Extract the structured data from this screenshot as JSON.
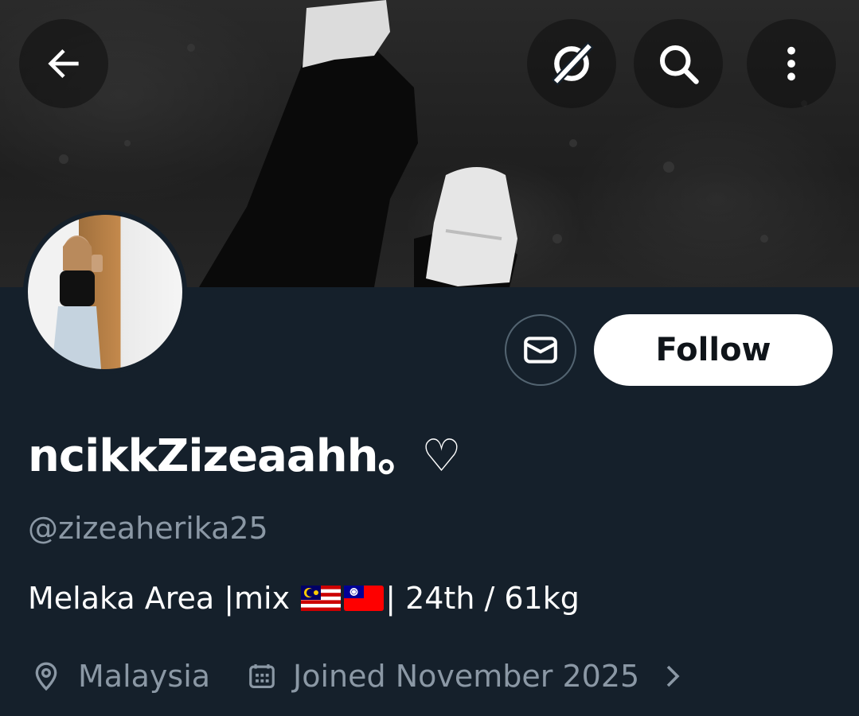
{
  "profile": {
    "display_name": "ncikkZizeaahh。♡",
    "handle": "@zizeaherika25",
    "bio_text": "Melaka Area |mix ",
    "bio_suffix": "| 24th / 61kg",
    "location": "Malaysia",
    "joined": "Joined November 2025"
  },
  "actions": {
    "follow_label": "Follow"
  },
  "icons": {
    "back": "arrow-left-icon",
    "grok": "grok-icon",
    "search": "search-icon",
    "more": "more-vertical-icon",
    "message": "envelope-icon",
    "location": "location-pin-icon",
    "calendar": "calendar-icon",
    "chevron": "chevron-right-icon",
    "flags": [
      "malaysia-flag-icon",
      "taiwan-flag-icon"
    ]
  },
  "colors": {
    "background": "#15202b",
    "secondary_text": "#8b98a5",
    "follow_bg": "#ffffff",
    "follow_text": "#0f1419"
  }
}
